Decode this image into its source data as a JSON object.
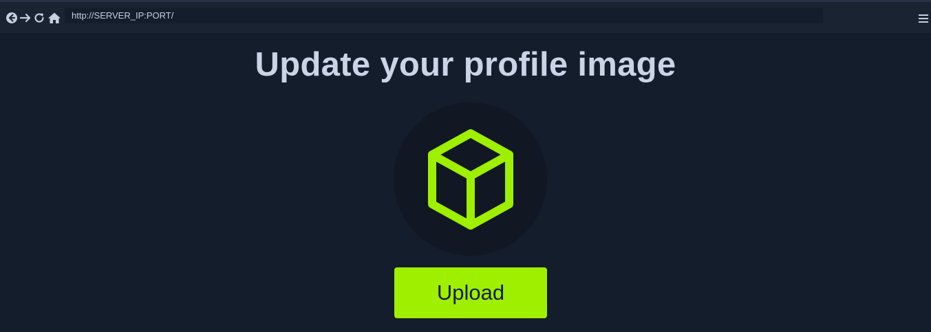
{
  "browser": {
    "url": "http://SERVER_IP:PORT/",
    "icons": [
      "back-icon",
      "forward-icon",
      "reload-icon",
      "home-icon",
      "menu-icon"
    ]
  },
  "main": {
    "title": "Update your profile image",
    "avatar_icon": "cube-icon",
    "upload_label": "Upload"
  },
  "colors": {
    "background": "#141d2b",
    "toolbar": "#1a2332",
    "accent": "#9fef00",
    "title": "#c9d4e6",
    "avatar_bg": "#111823"
  }
}
